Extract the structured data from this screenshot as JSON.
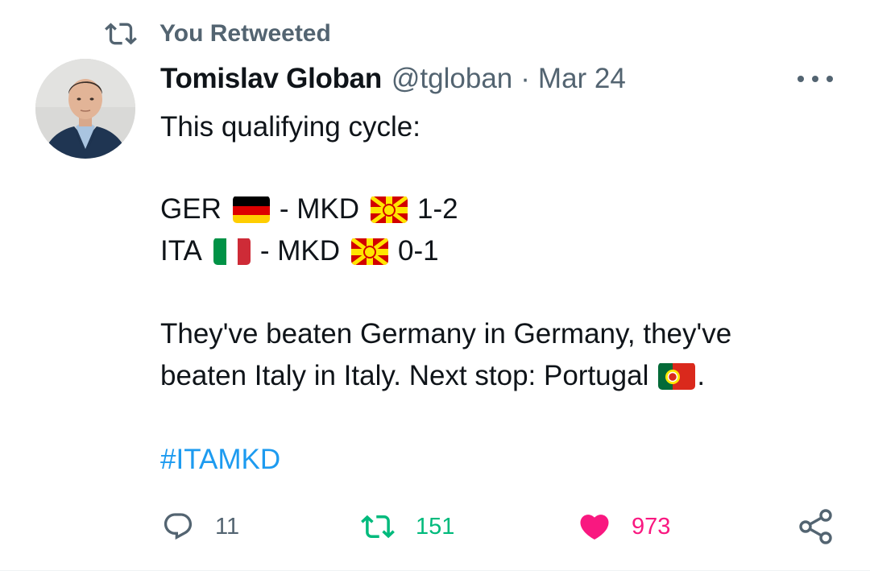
{
  "retweet_context": {
    "label": "You Retweeted",
    "icon": "retweet-icon"
  },
  "author": {
    "name": "Tomislav Globan",
    "handle": "@tgloban",
    "separator": "·",
    "date": "Mar 24",
    "avatar": "avatar-photo"
  },
  "tweet": {
    "line1": "This qualifying cycle:",
    "match1": {
      "home": "GER",
      "home_flag": "germany-flag",
      "sep": "- MKD",
      "away_flag": "north-macedonia-flag",
      "score": "1-2"
    },
    "match2": {
      "home": "ITA",
      "home_flag": "italy-flag",
      "sep": "- MKD",
      "away_flag": "north-macedonia-flag",
      "score": "0-1"
    },
    "line2": "They've beaten Germany in Germany, they've",
    "line3_text": "beaten Italy in Italy. Next stop: Portugal",
    "line3_flag": "portugal-flag",
    "line3_end": ".",
    "hashtag": "#ITAMKD"
  },
  "actions": {
    "replies": "11",
    "retweets": "151",
    "likes": "973",
    "reply_icon": "reply-icon",
    "retweet_icon": "retweet-icon",
    "like_icon": "heart-icon",
    "share_icon": "share-icon"
  },
  "colors": {
    "text": "#0f1419",
    "secondary": "#536471",
    "link": "#1d9bf0",
    "retweet_active": "#00ba7c",
    "like_active": "#f91880"
  }
}
